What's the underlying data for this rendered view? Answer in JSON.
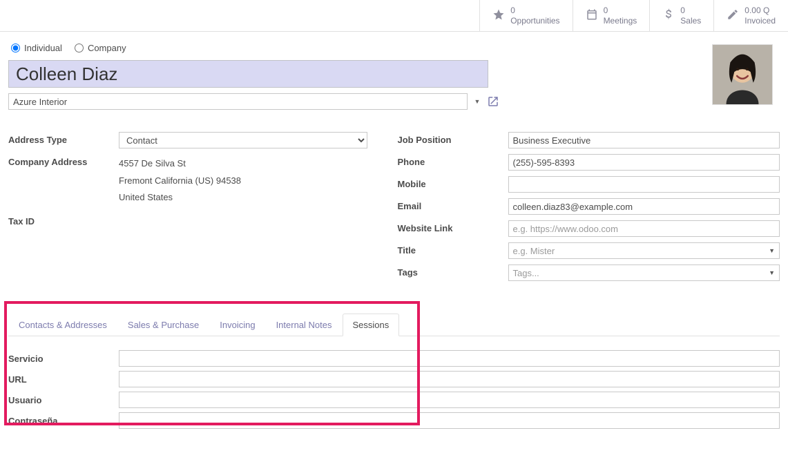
{
  "statbar": [
    {
      "icon": "star",
      "value": "0",
      "label": "Opportunities"
    },
    {
      "icon": "calendar",
      "value": "0",
      "label": "Meetings"
    },
    {
      "icon": "dollar",
      "value": "0",
      "label": "Sales"
    },
    {
      "icon": "edit",
      "value": "0.00 Q",
      "label": "Invoiced"
    }
  ],
  "header": {
    "radios": {
      "individual": "Individual",
      "company": "Company",
      "selected": "individual"
    },
    "name": "Colleen Diaz",
    "company": "Azure Interior"
  },
  "left": {
    "address_type_label": "Address Type",
    "address_type_value": "Contact",
    "company_address_label": "Company Address",
    "addr_line1": "4557 De Silva St",
    "addr_line2": "Fremont  California (US)  94538",
    "addr_line3": "United States",
    "tax_id_label": "Tax ID"
  },
  "right": {
    "job_label": "Job Position",
    "job": "Business Executive",
    "phone_label": "Phone",
    "phone": "(255)-595-8393",
    "mobile_label": "Mobile",
    "mobile": "",
    "email_label": "Email",
    "email": "colleen.diaz83@example.com",
    "website_label": "Website Link",
    "website_ph": "e.g. https://www.odoo.com",
    "title_label": "Title",
    "title_ph": "e.g. Mister",
    "tags_label": "Tags",
    "tags_ph": "Tags..."
  },
  "tabs": {
    "items": [
      "Contacts & Addresses",
      "Sales & Purchase",
      "Invoicing",
      "Internal Notes",
      "Sessions"
    ],
    "active": 4
  },
  "sessions": {
    "servicio": "Servicio",
    "url": "URL",
    "usuario": "Usuario",
    "contrasena": "Contraseña"
  }
}
